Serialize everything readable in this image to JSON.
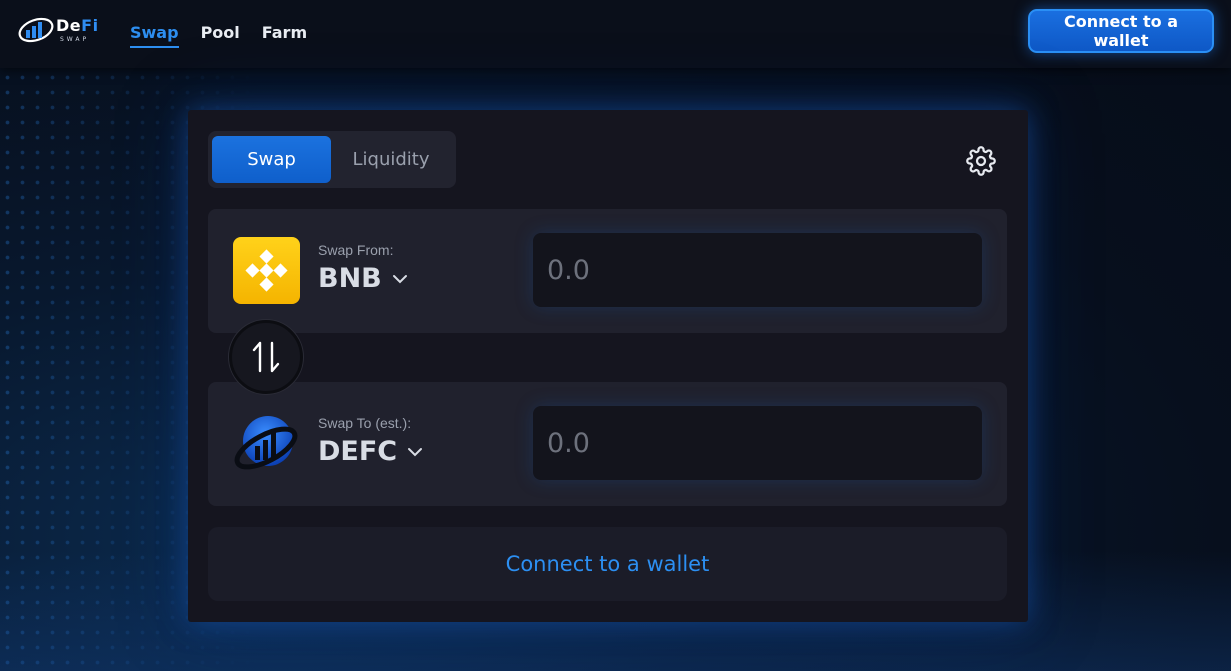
{
  "brand": {
    "name_main": "De",
    "name_accent": "Fi",
    "sub": "SWAP"
  },
  "nav": {
    "items": [
      {
        "label": "Swap",
        "active": true
      },
      {
        "label": "Pool",
        "active": false
      },
      {
        "label": "Farm",
        "active": false
      }
    ]
  },
  "header": {
    "connect_label": "Connect to a wallet"
  },
  "tabs": {
    "swap_label": "Swap",
    "liquidity_label": "Liquidity",
    "active": "Swap"
  },
  "from": {
    "label": "Swap From:",
    "token": "BNB",
    "icon": "bnb-icon",
    "placeholder": "0.0",
    "value": ""
  },
  "to": {
    "label": "Swap To (est.):",
    "token": "DEFC",
    "icon": "defc-icon",
    "placeholder": "0.0",
    "value": ""
  },
  "actions": {
    "connect_label": "Connect to a wallet"
  },
  "colors": {
    "accent": "#2d8ef0",
    "background": "#070f1d",
    "card": "#15151f",
    "panel": "#20212d",
    "bnb": "#f5b400"
  }
}
